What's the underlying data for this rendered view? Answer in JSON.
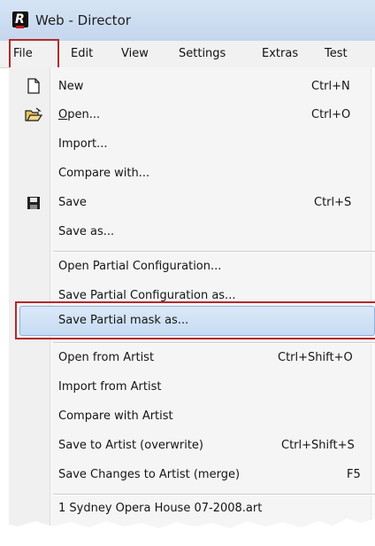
{
  "window": {
    "title": "Web - Director"
  },
  "menubar": {
    "file": "File",
    "edit": "Edit",
    "view": "View",
    "settings": "Settings",
    "extras": "Extras",
    "test": "Test"
  },
  "file_menu": {
    "new": "New",
    "new_shortcut": "Ctrl+N",
    "open": "Open...",
    "open_shortcut": "Ctrl+O",
    "import": "Import...",
    "compare_with": "Compare with...",
    "save": "Save",
    "save_shortcut": "Ctrl+S",
    "save_as": "Save as...",
    "open_partial_configuration": "Open Partial Configuration...",
    "save_partial_configuration_as": "Save Partial Configuration as...",
    "save_partial_mask_as": "Save Partial mask as...",
    "open_from_artist": "Open from Artist",
    "open_from_artist_shortcut": "Ctrl+Shift+O",
    "import_from_artist": "Import from Artist",
    "compare_with_artist": "Compare with Artist",
    "save_to_artist_overwrite": "Save to Artist (overwrite)",
    "save_to_artist_overwrite_shortcut": "Ctrl+Shift+S",
    "save_changes_to_artist_merge": "Save Changes to Artist (merge)",
    "save_changes_to_artist_merge_shortcut": "F5",
    "recent_file_1": "1 Sydney Opera House 07-2008.art"
  },
  "colors": {
    "highlight_frame": "#b42a2a",
    "selection": "#c6dbf3"
  }
}
